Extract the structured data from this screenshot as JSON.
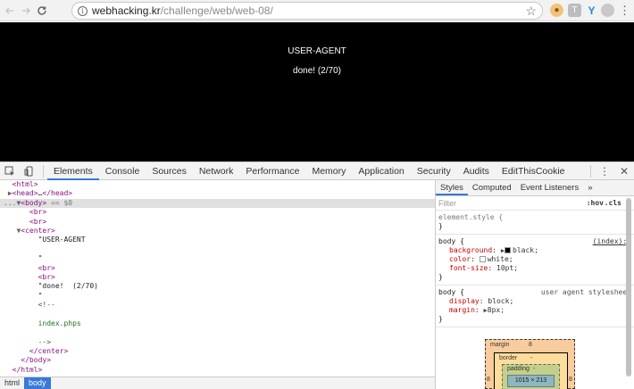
{
  "browser": {
    "url_host": "webhacking.kr",
    "url_path": "/challenge/web/web-08/",
    "back_icon": "arrow-left",
    "forward_icon": "arrow-right",
    "reload_icon": "reload",
    "info_icon": "i",
    "star_icon": "☆",
    "menu_icon": "⋮",
    "extensions": [
      {
        "name": "cookie-extension",
        "glyph": "🍪",
        "color": "#e6a23c"
      },
      {
        "name": "t-extension",
        "glyph": "T",
        "color": "#9e9e9e"
      },
      {
        "name": "y-extension",
        "glyph": "Y",
        "color": "#1e88e5"
      },
      {
        "name": "globe-extension",
        "glyph": "◍",
        "color": "#9e9e9e"
      }
    ]
  },
  "page": {
    "line1": "USER-AGENT",
    "line2": "done! (2/70)"
  },
  "devtools": {
    "tabs": [
      "Elements",
      "Console",
      "Sources",
      "Network",
      "Performance",
      "Memory",
      "Application",
      "Security",
      "Audits",
      "EditThisCookie"
    ],
    "active_tab": "Elements",
    "elements_lines": [
      {
        "indent": "",
        "tri": "",
        "parts": [
          [
            "tag",
            "<html>"
          ]
        ]
      },
      {
        "indent": "",
        "tri": "▶",
        "parts": [
          [
            "tag",
            "<head>"
          ],
          [
            "txt",
            "…"
          ],
          [
            "tag",
            "</head>"
          ]
        ]
      },
      {
        "indent": "",
        "tri": "▼",
        "selected": true,
        "prefix": "...",
        "parts": [
          [
            "tag",
            "<body>"
          ],
          [
            "attr-eq",
            " == $0"
          ]
        ]
      },
      {
        "indent": "    ",
        "tri": "",
        "parts": [
          [
            "tag",
            "<br>"
          ]
        ]
      },
      {
        "indent": "    ",
        "tri": "",
        "parts": [
          [
            "tag",
            "<br>"
          ]
        ]
      },
      {
        "indent": "  ",
        "tri": "▼",
        "parts": [
          [
            "tag",
            "<center>"
          ]
        ]
      },
      {
        "indent": "      ",
        "tri": "",
        "parts": [
          [
            "txt",
            "\"USER-AGENT"
          ]
        ]
      },
      {
        "indent": "",
        "tri": "",
        "parts": [
          [
            "txt",
            ""
          ]
        ]
      },
      {
        "indent": "      ",
        "tri": "",
        "parts": [
          [
            "txt",
            "\""
          ]
        ]
      },
      {
        "indent": "      ",
        "tri": "",
        "parts": [
          [
            "tag",
            "<br>"
          ]
        ]
      },
      {
        "indent": "      ",
        "tri": "",
        "parts": [
          [
            "tag",
            "<br>"
          ]
        ]
      },
      {
        "indent": "      ",
        "tri": "",
        "parts": [
          [
            "txt",
            "\"done!  (2/70)"
          ]
        ]
      },
      {
        "indent": "      ",
        "tri": "",
        "parts": [
          [
            "txt",
            "\""
          ]
        ]
      },
      {
        "indent": "      ",
        "tri": "",
        "parts": [
          [
            "cmt",
            "<!--"
          ]
        ]
      },
      {
        "indent": "",
        "tri": "",
        "parts": [
          [
            "txt",
            ""
          ]
        ]
      },
      {
        "indent": "      ",
        "tri": "",
        "parts": [
          [
            "cmt",
            "index.phps"
          ]
        ]
      },
      {
        "indent": "",
        "tri": "",
        "parts": [
          [
            "txt",
            ""
          ]
        ]
      },
      {
        "indent": "      ",
        "tri": "",
        "parts": [
          [
            "cmt",
            "-->"
          ]
        ]
      },
      {
        "indent": "    ",
        "tri": "",
        "parts": [
          [
            "tag",
            "</center>"
          ]
        ]
      },
      {
        "indent": "  ",
        "tri": "",
        "parts": [
          [
            "tag",
            "</body>"
          ]
        ]
      },
      {
        "indent": "",
        "tri": "",
        "parts": [
          [
            "tag",
            "</html>"
          ]
        ]
      }
    ],
    "breadcrumbs": [
      "html",
      "body"
    ],
    "active_crumb": "body",
    "styles": {
      "tabs": [
        "Styles",
        "Computed",
        "Event Listeners",
        "»"
      ],
      "filter_placeholder": "Filter",
      "hov": ":hov",
      "cls": ".cls",
      "plus": "+",
      "rules": [
        {
          "selector": "element.style {",
          "source": "",
          "props": [],
          "close": "}",
          "muted": true
        },
        {
          "selector": "body {",
          "source": "(index):5",
          "props": [
            {
              "name": "background",
              "value": "black;",
              "swatch": "#000000",
              "tri": true
            },
            {
              "name": "color",
              "value": "white;",
              "swatch": "#ffffff",
              "tri": false
            },
            {
              "name": "font-size",
              "value": "10pt;",
              "swatch": "",
              "tri": false
            }
          ],
          "close": "}"
        },
        {
          "selector": "body {",
          "source": "user agent stylesheet",
          "ua": true,
          "props": [
            {
              "name": "display",
              "value": "block;",
              "swatch": "",
              "tri": false
            },
            {
              "name": "margin",
              "value": "8px;",
              "swatch": "",
              "tri": true
            }
          ],
          "close": "}"
        }
      ]
    },
    "boxmodel": {
      "margin_label": "margin",
      "margin_value": "8",
      "border_label": "border",
      "border_value": "-",
      "padding_label": "padding",
      "padding_value": "-",
      "content": "1015 × 213",
      "side_value": "8"
    }
  }
}
